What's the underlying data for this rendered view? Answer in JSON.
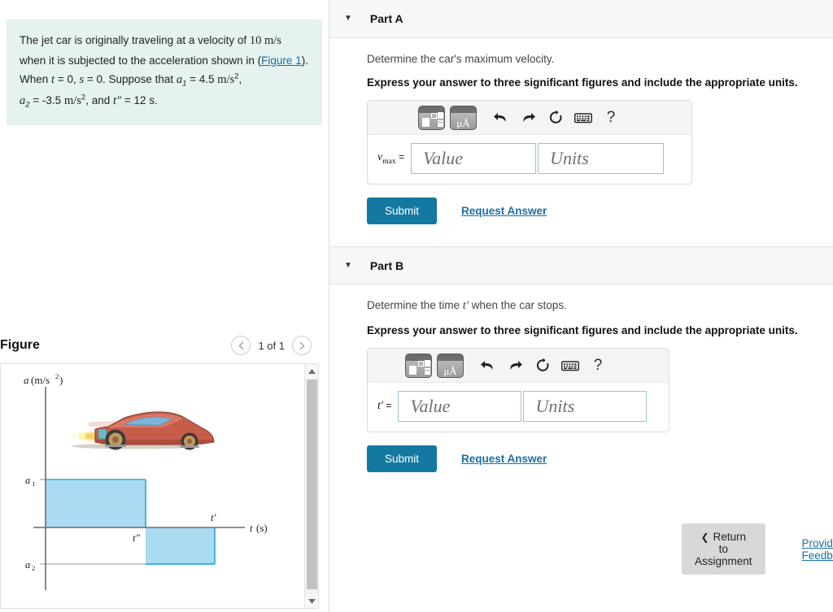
{
  "problem": {
    "text_line1_a": "The jet car is originally traveling at a velocity of ",
    "v0": "10",
    "unit_v": "m/s",
    "text_line1_b": " when it is subjected to the acceleration shown in (",
    "figure_link": "Figure 1",
    "text_line1_c": ").",
    "text_line2_a": "When ",
    "var_t": "t",
    "eq1": " = 0, ",
    "var_s": "s",
    "eq2": " = 0. Suppose that ",
    "a1_label": "a",
    "a1_sub": "1",
    "a1_value": " = 4.5 ",
    "a1_unit": "m/s",
    "a1_exp": "2",
    "comma": ",",
    "a2_label": "a",
    "a2_sub": "2",
    "a2_value": " = -3.5 ",
    "a2_unit": "m/s",
    "a2_exp": "2",
    "and_text": ", and ",
    "tpp": "t″",
    "tpp_value": " = 12 s."
  },
  "figure": {
    "title": "Figure",
    "pager_label": "1 of 1",
    "prev_icon": "chevron-left-icon",
    "next_icon": "chevron-right-icon",
    "scroll_up_icon": "triangle-up-icon",
    "scroll_down_icon": "triangle-down-icon"
  },
  "chart_data": {
    "type": "bar",
    "title": "",
    "xlabel": "t (s)",
    "ylabel": "a (m/s²)",
    "grid": false,
    "legend": null,
    "axis_y_label_text": "a (m/s",
    "axis_y_label_exp": "2",
    "axis_y_label_tail": ")",
    "axis_x_label_text": "t (s)",
    "tick_labels_y": [
      "a₁",
      "a₂"
    ],
    "tick_labels_x": [
      "t″",
      "t′"
    ],
    "y_tick_a1_base": "a",
    "y_tick_a1_sub": "1",
    "y_tick_a2_base": "a",
    "y_tick_a2_sub": "2",
    "x_tick_tpp": "t″",
    "x_tick_tp": "t′",
    "categories": [
      "0 to t″",
      "t″ to t′"
    ],
    "values": [
      4.5,
      -3.5
    ],
    "ylim": [
      -5.0,
      6.0
    ],
    "xlim": [
      0,
      16
    ],
    "bars": [
      {
        "x_start": 0,
        "x_end": 12,
        "height": 4.5,
        "label": "a1",
        "color": "#a8dcf0"
      },
      {
        "x_start": 12,
        "x_end": 21.5,
        "height": -3.5,
        "label": "a2",
        "color": "#a8dcf0"
      }
    ],
    "bar_fill": "#a9dcf2",
    "bar_stroke": "#2aa8dd",
    "axis_color": "#6b6b6b",
    "annotation_image": "jet-car-illustration"
  },
  "parts": [
    {
      "id": "A",
      "title": "Part A",
      "caret_icon": "caret-down-icon",
      "question": "Determine the car's maximum velocity.",
      "instruction": "Express your answer to three significant figures and include the appropriate units.",
      "variable_base": "v",
      "variable_sub": "max",
      "equals": "=",
      "value_placeholder": "Value",
      "units_placeholder": "Units",
      "value_current": "",
      "units_current": "",
      "submit_label": "Submit",
      "request_label": "Request Answer",
      "toolbar": {
        "template_icon": "math-template-icon",
        "units_icon": "units-angstrom-icon",
        "units_icon_text": "μÅ",
        "undo_icon": "undo-icon",
        "redo_icon": "redo-icon",
        "reset_icon": "reset-icon",
        "keyboard_icon": "keyboard-icon",
        "help_icon": "help-icon",
        "help_text": "?"
      }
    },
    {
      "id": "B",
      "title": "Part B",
      "caret_icon": "caret-down-icon",
      "question_pre": "Determine the time ",
      "question_var": "t′",
      "question_post": " when the car stops.",
      "question": "Determine the time t′ when the car stops.",
      "instruction": "Express your answer to three significant figures and include the appropriate units.",
      "variable_base": "t′",
      "variable_sub": "",
      "equals": "=",
      "value_placeholder": "Value",
      "units_placeholder": "Units",
      "value_current": "",
      "units_current": "",
      "submit_label": "Submit",
      "request_label": "Request Answer",
      "toolbar": {
        "template_icon": "math-template-icon",
        "units_icon": "units-angstrom-icon",
        "units_icon_text": "μÅ",
        "undo_icon": "undo-icon",
        "redo_icon": "redo-icon",
        "reset_icon": "reset-icon",
        "keyboard_icon": "keyboard-icon",
        "help_icon": "help-icon",
        "help_text": "?"
      }
    }
  ],
  "footer": {
    "return_label": "Return to Assignment",
    "return_icon": "chevron-left-icon",
    "feedback_label": "Provide Feedback"
  },
  "colors": {
    "accent": "#1379a0",
    "link": "#1a6fa8",
    "problem_bg": "#e6f2f0",
    "bar_fill": "#a9dcf2",
    "bar_stroke": "#2aa8dd",
    "header_bg": "#f7f7f7"
  }
}
